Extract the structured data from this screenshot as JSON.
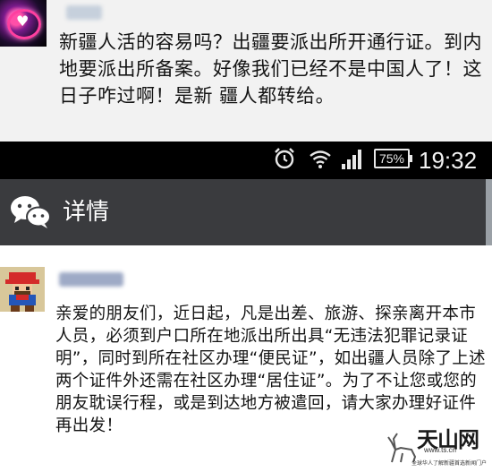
{
  "top_post": {
    "text": "新疆人活的容易吗？出疆要派出所开通行证。到内地要派出所备案。好像我们已经不是中国人了！这日子咋过啊！是新 疆人都转给。"
  },
  "status_bar": {
    "alarm_icon": "alarm-clock-icon",
    "wifi_icon": "wifi-icon",
    "signal_icon": "cell-signal-icon",
    "battery": "75%",
    "time": "19:32"
  },
  "title_bar": {
    "app_icon": "wechat-icon",
    "title": "详情"
  },
  "bottom_post": {
    "text": "亲爱的朋友们，近日起，凡是出差、旅游、探亲离开本市人员，必须到户口所在地派出所出具“无违法犯罪记录证明”，同时到所在社区办理“便民证”，如出疆人员除了上述两个证件外还需在社区办理“居住证”。为了不让您或您的朋友耽误行程，或是到达地方被遣回，请大家办理好证件再出发！"
  },
  "watermark": {
    "title": "天山网",
    "url": "www.ts.cn",
    "tagline": "全球华人了解新疆首选新闻门户"
  },
  "colors": {
    "status_bar_bg": "#000000",
    "title_bar_bg": "#3a3b3e",
    "top_post_bg": "#f2f2f2"
  }
}
